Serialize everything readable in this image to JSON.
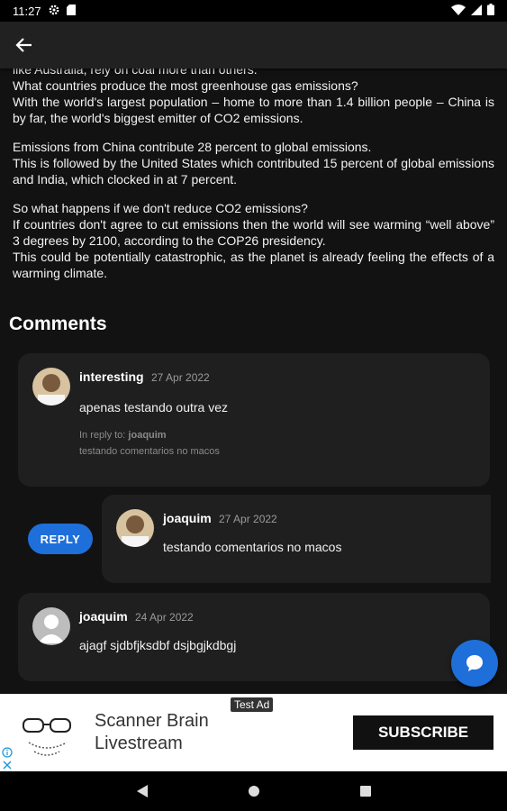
{
  "status_bar": {
    "time": "11:27"
  },
  "article": {
    "paragraphs": [
      [
        "like Australia, rely on coal more than others.",
        "What countries produce the most greenhouse gas emissions?",
        "With the world's largest population – home to more than 1.4 billion people – China is by far, the world's biggest emitter of CO2 emissions."
      ],
      [
        "Emissions from China contribute 28 percent to global emissions.",
        "This is followed by the United States which contributed 15 percent of global emissions and India, which clocked in at 7 percent."
      ],
      [
        "So what happens if we don't reduce CO2 emissions?",
        "If countries don't agree to cut emissions then the world will see warming “well above” 3 degrees by 2100, according to the COP26 presidency.",
        "This could be potentially catastrophic, as the planet is already feeling the effects of a warming climate."
      ]
    ]
  },
  "comments": {
    "title": "Comments",
    "items": [
      {
        "author": "interesting",
        "date": "27 Apr 2022",
        "text": "apenas testando outra vez",
        "reply_to_prefix": "In reply to:",
        "reply_to_author": "joaquim",
        "reply_to_text": "testando comentarios no macos"
      },
      {
        "author": "joaquim",
        "date": "27 Apr 2022",
        "text": "testando comentarios no macos"
      },
      {
        "author": "joaquim",
        "date": "24 Apr 2022",
        "text": "ajagf sjdbfjksdbf dsjbgjkdbgj"
      }
    ],
    "reply_label": "REPLY"
  },
  "ad": {
    "tag": "Test Ad",
    "title": "Scanner Brain Livestream",
    "button": "SUBSCRIBE"
  },
  "colors": {
    "accent": "#1e6fd9",
    "card": "#1f1f1f",
    "background": "#121212"
  }
}
